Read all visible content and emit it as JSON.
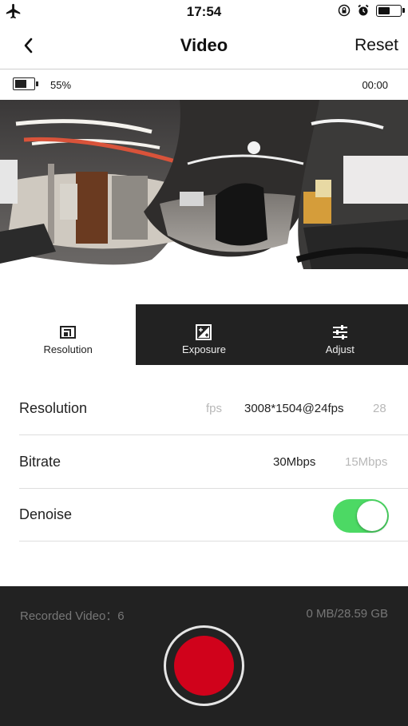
{
  "status_bar": {
    "time": "17:54",
    "battery_level": 0.45,
    "icons": [
      "airplane-icon",
      "rotation-lock-icon",
      "alarm-icon",
      "battery-icon"
    ]
  },
  "nav": {
    "title": "Video",
    "reset_label": "Reset",
    "back_icon": "chevron-left-icon"
  },
  "camera": {
    "battery_percent": "55%",
    "battery_level": 0.55,
    "elapsed": "00:00"
  },
  "tabs": [
    {
      "label": "Resolution",
      "icon": "resolution-icon",
      "active": true
    },
    {
      "label": "Exposure",
      "icon": "exposure-icon",
      "active": false
    },
    {
      "label": "Adjust",
      "icon": "adjust-sliders-icon",
      "active": false
    }
  ],
  "settings": {
    "resolution": {
      "label": "Resolution",
      "prev_option": "fps",
      "selected": "3008*1504@24fps",
      "next_option": "28"
    },
    "bitrate": {
      "label": "Bitrate",
      "selected": "30Mbps",
      "next_option": "15Mbps"
    },
    "denoise": {
      "label": "Denoise",
      "enabled": true
    }
  },
  "bottom": {
    "recorded_label": "Recorded Video：6",
    "storage": "0 MB/28.59 GB"
  },
  "colors": {
    "dark_panel": "#222222",
    "toggle_on": "#4cd964",
    "record": "#d0021b"
  }
}
